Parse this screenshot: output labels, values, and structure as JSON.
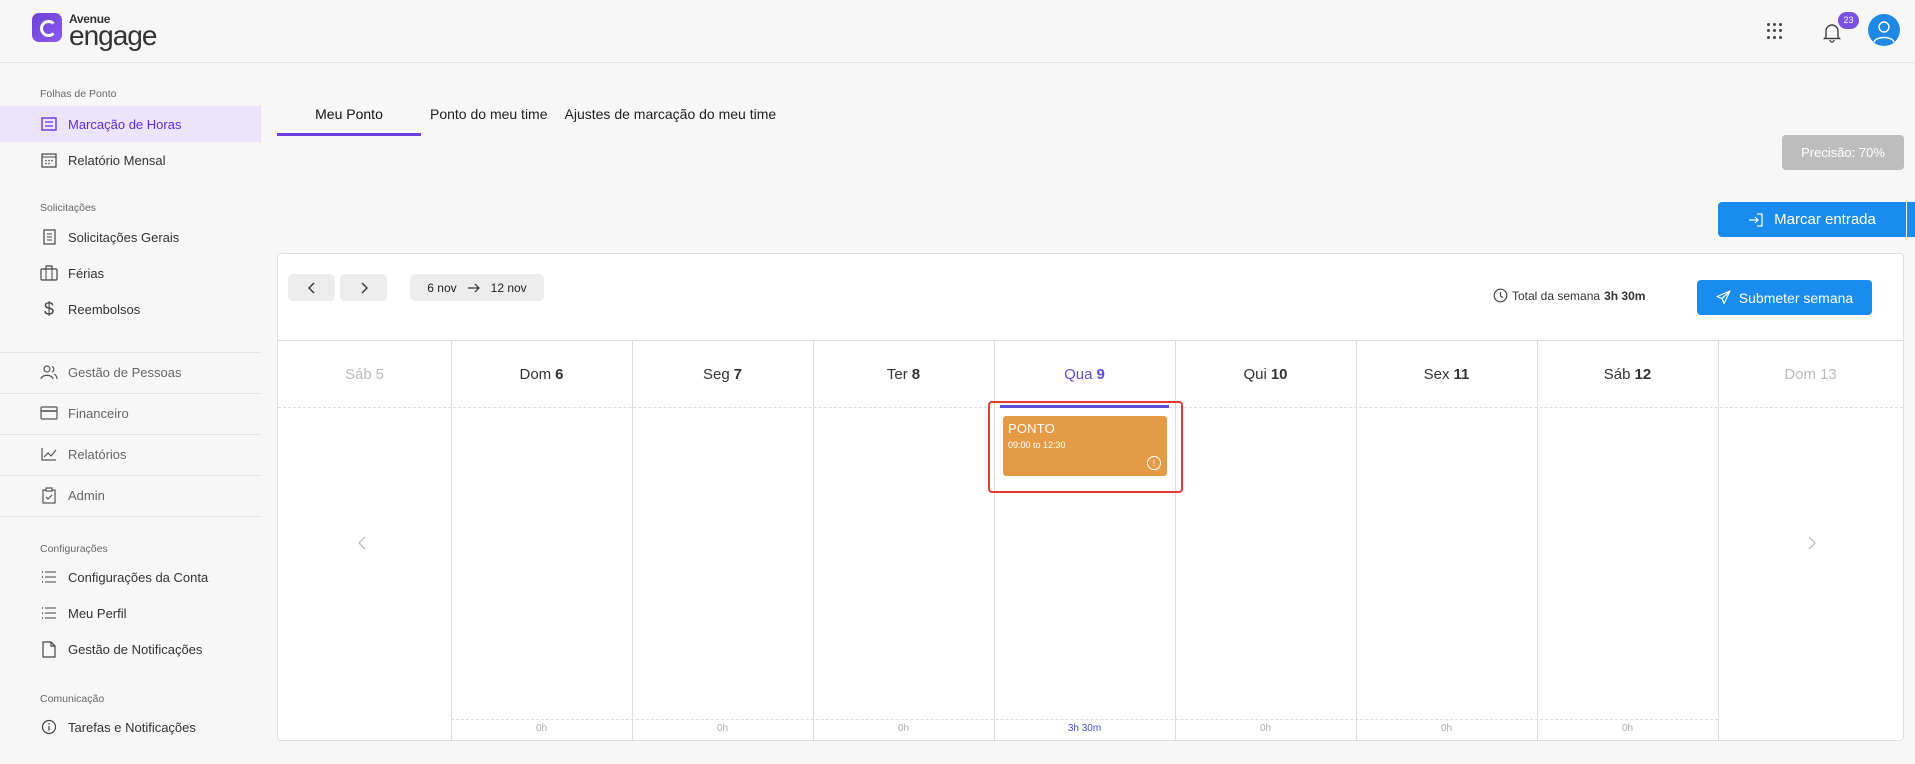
{
  "brand": {
    "small": "Avenue",
    "big": "engage",
    "accent": "#6b3fd6"
  },
  "topbar": {
    "apps_icon": "grid-icon",
    "notifications_count": "23",
    "bell_icon": "bell-icon",
    "avatar_icon": "user-icon"
  },
  "sidebar": {
    "sections": [
      {
        "title": "Folhas de Ponto",
        "items": [
          "Marcação de Horas",
          "Relatório Mensal"
        ]
      },
      {
        "title": "Solicitações",
        "items": [
          "Solicitações Gerais",
          "Férias",
          "Reembolsos"
        ]
      },
      {
        "title": "",
        "items": [
          "Gestão de Pessoas",
          "Financeiro",
          "Relatórios",
          "Admin"
        ]
      },
      {
        "title": "Configurações",
        "items": [
          "Configurações da Conta",
          "Meu Perfil",
          "Gestão de Notificações"
        ]
      },
      {
        "title": "Comunicação",
        "items": [
          "Tarefas e Notificações"
        ]
      }
    ],
    "active_item": "Marcação de Horas"
  },
  "tabs": [
    {
      "label": "Meu Ponto",
      "active": true
    },
    {
      "label": "Ponto do meu time",
      "active": false
    },
    {
      "label": "Ajustes de marcação do meu time",
      "active": false
    }
  ],
  "precisao": "Precisão: 70%",
  "marcar_entrada": "Marcar entrada",
  "calendar": {
    "range_start": "6 nov",
    "range_end": "12 nov",
    "total_label": "Total da semana",
    "total_value": "3h 30m",
    "submit_label": "Submeter semana",
    "days": [
      {
        "name": "Sáb",
        "num": "5",
        "state": "fade",
        "footer": ""
      },
      {
        "name": "Dom",
        "num": "6",
        "state": "",
        "footer": "0h"
      },
      {
        "name": "Seg",
        "num": "7",
        "state": "",
        "footer": "0h"
      },
      {
        "name": "Ter",
        "num": "8",
        "state": "",
        "footer": "0h"
      },
      {
        "name": "Qua",
        "num": "9",
        "state": "today",
        "footer": "3h 30m"
      },
      {
        "name": "Qui",
        "num": "10",
        "state": "",
        "footer": "0h"
      },
      {
        "name": "Sex",
        "num": "11",
        "state": "",
        "footer": "0h"
      },
      {
        "name": "Sáb",
        "num": "12",
        "state": "",
        "footer": "0h"
      },
      {
        "name": "Dom",
        "num": "13",
        "state": "fade",
        "footer": ""
      }
    ],
    "event": {
      "title": "PONTO",
      "time": "09:00 to 12:30",
      "color": "#e59a45"
    }
  }
}
